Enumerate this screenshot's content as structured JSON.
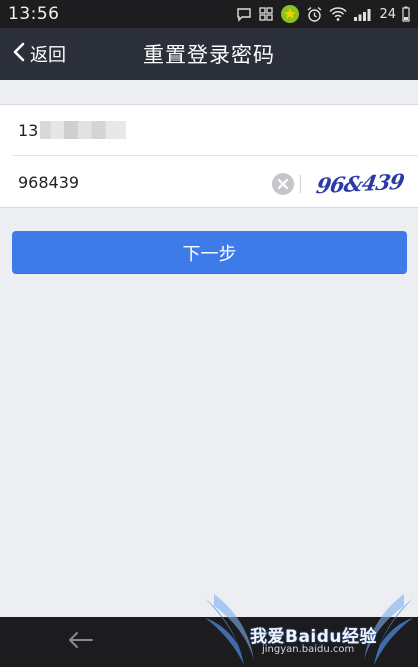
{
  "status_bar": {
    "time": "13:56",
    "battery": "24",
    "icons": [
      "chat-icon",
      "app-grid-icon",
      "security-app-icon",
      "alarm-icon",
      "wifi-icon",
      "signal-icon",
      "battery-icon"
    ]
  },
  "header": {
    "back_label": "返回",
    "title": "重置登录密码"
  },
  "form": {
    "phone_prefix": "13",
    "phone_masked": true,
    "code_value": "968439",
    "captcha_text": "96&439"
  },
  "actions": {
    "next_label": "下一步"
  },
  "watermark": {
    "main": "我爱Baidu经验",
    "sub": "jingyan.baidu.com"
  },
  "colors": {
    "header_bg": "#2a2f3a",
    "page_bg": "#eceef2",
    "primary": "#3d7be8",
    "captcha": "#2b3aa8"
  }
}
